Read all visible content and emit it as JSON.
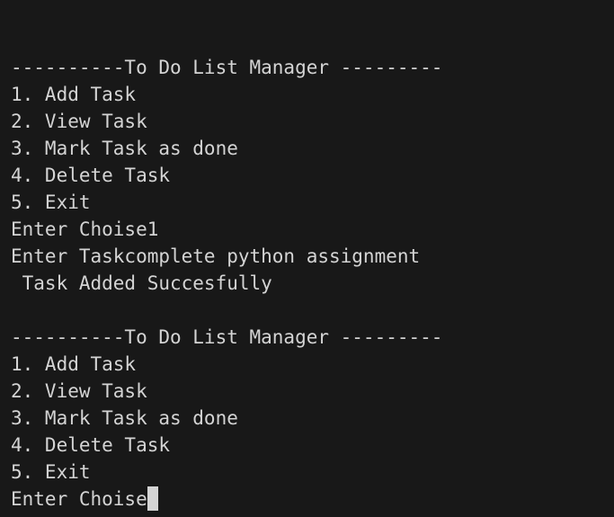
{
  "terminal": {
    "lines": [
      "----------To Do List Manager ---------",
      "1. Add Task",
      "2. View Task",
      "3. Mark Task as done",
      "4. Delete Task",
      "5. Exit",
      "Enter Choise1",
      "Enter Taskcomplete python assignment",
      " Task Added Succesfully",
      "",
      "----------To Do List Manager ---------",
      "1. Add Task",
      "2. View Task",
      "3. Mark Task as done",
      "4. Delete Task",
      "5. Exit"
    ],
    "prompt": "Enter Choise"
  },
  "colors": {
    "background": "#181818",
    "text": "#d4d4d4"
  }
}
